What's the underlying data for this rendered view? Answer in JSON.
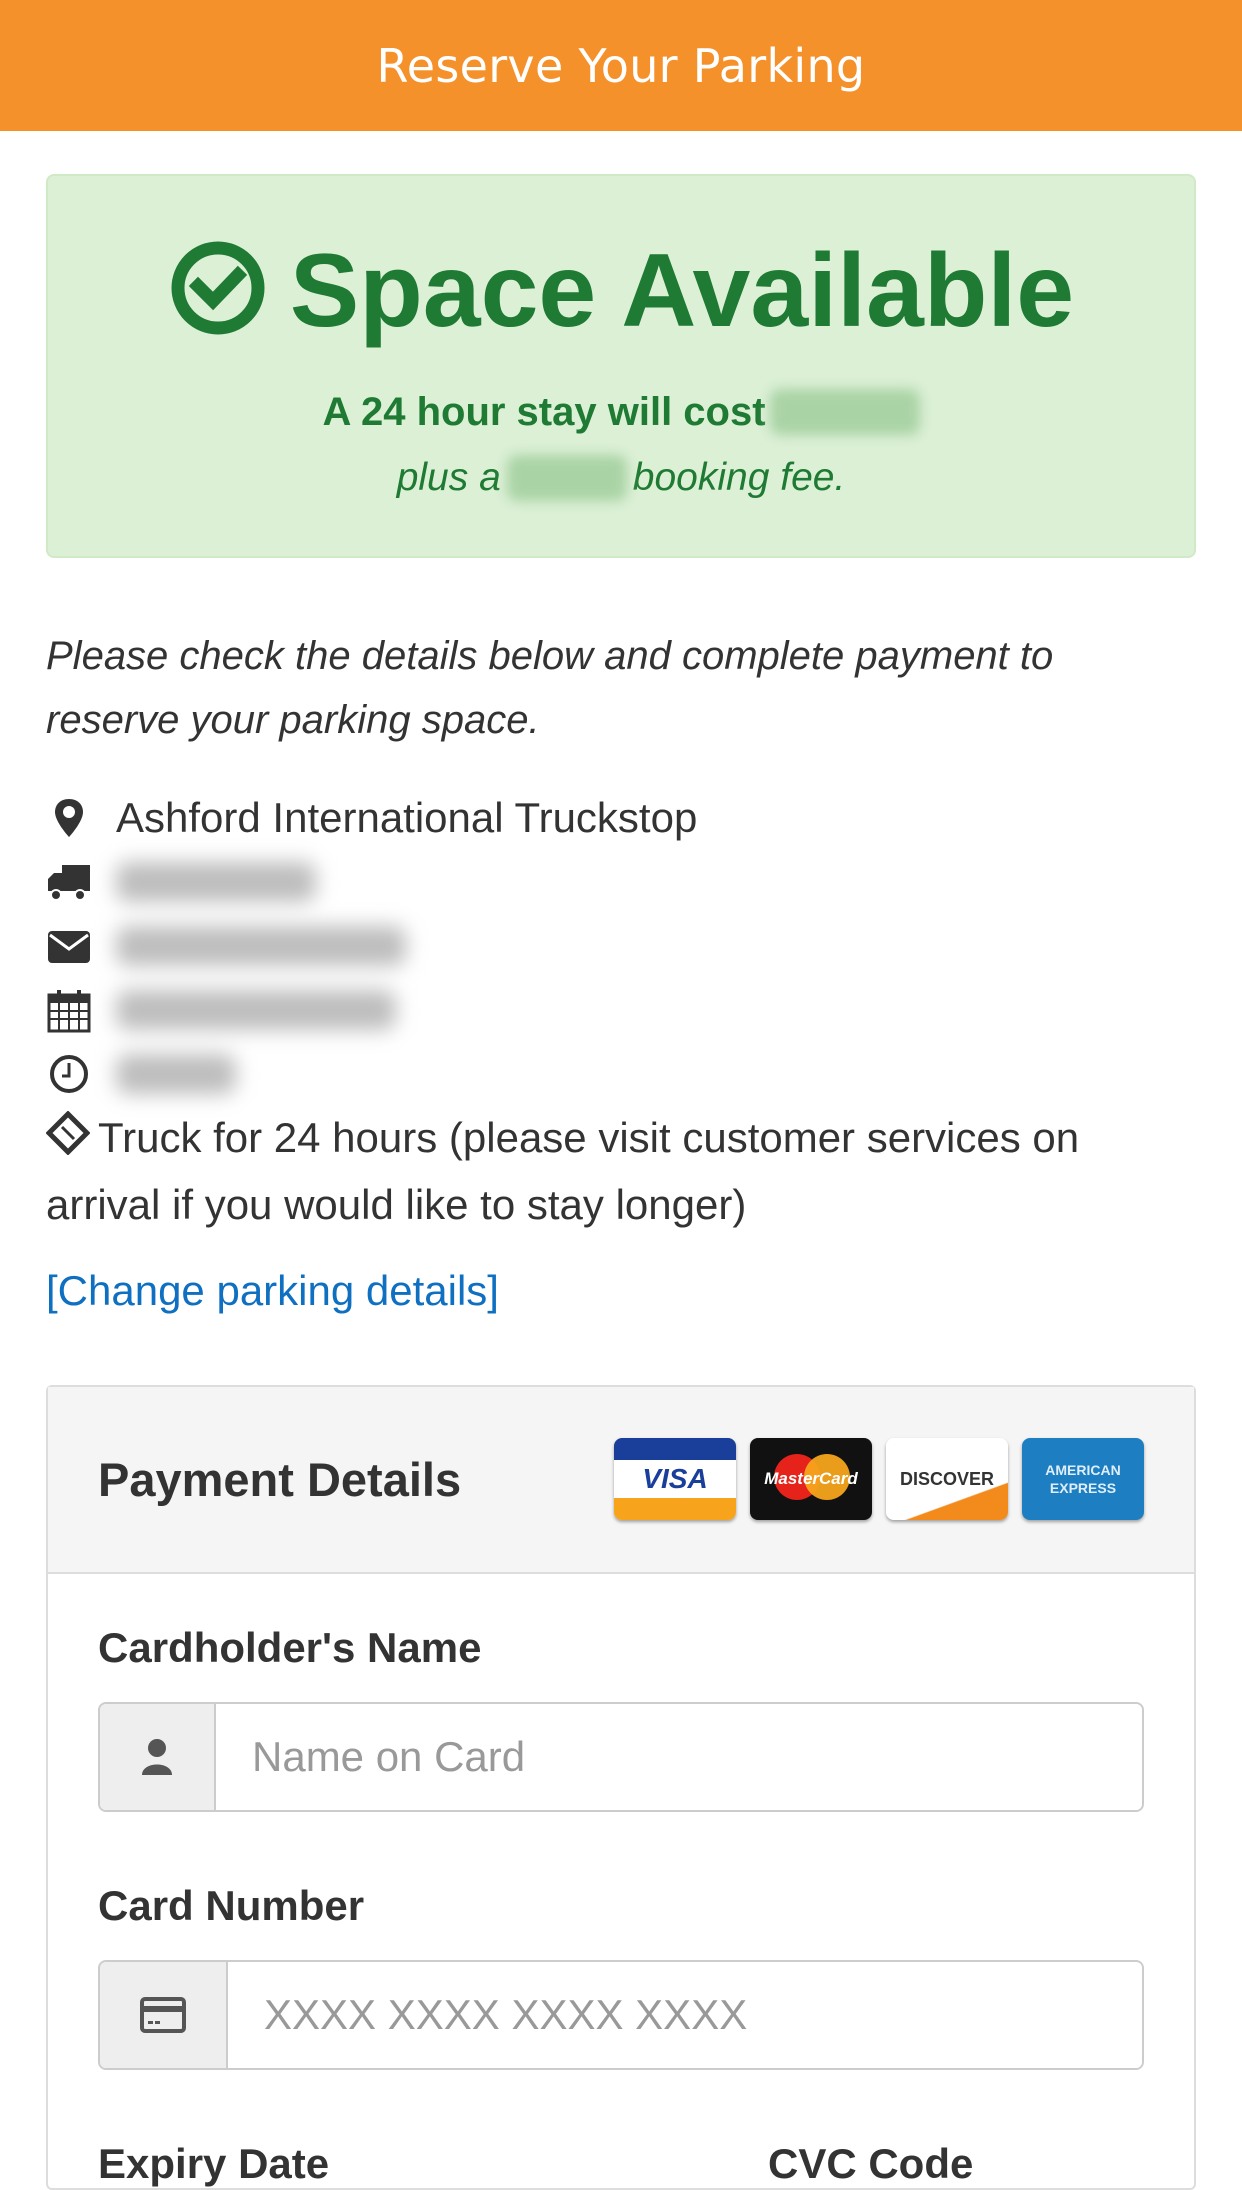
{
  "header": {
    "title": "Reserve Your Parking"
  },
  "availability": {
    "status": "Space Available",
    "status_icon": "check-circle-icon",
    "cost_prefix": "A 24 hour stay will cost",
    "cost_value": "[redacted]",
    "fee_prefix": "plus a",
    "fee_value": "[redacted]",
    "fee_suffix": "booking fee.",
    "color": "#1f7a34",
    "background": "#dcf0d6"
  },
  "intro": "Please check the details below and complete payment to reserve your parking space.",
  "details": [
    {
      "icon": "map-marker-icon",
      "text": "Ashford International Truckstop",
      "redacted": false
    },
    {
      "icon": "truck-icon",
      "text": "[redacted]",
      "redacted": true
    },
    {
      "icon": "envelope-icon",
      "text": "[redacted]",
      "redacted": true
    },
    {
      "icon": "calendar-icon",
      "text": "[redacted]",
      "redacted": true
    },
    {
      "icon": "clock-icon",
      "text": "[redacted]",
      "redacted": true
    }
  ],
  "ticket": {
    "icon": "tag-icon",
    "text": "Truck for 24 hours (please visit customer services on arrival if you would like to stay longer)"
  },
  "change_link": "[Change parking details]",
  "payment": {
    "title": "Payment Details",
    "cards": [
      {
        "name": "VISA",
        "icon": "visa-card-icon"
      },
      {
        "name": "MasterCard",
        "icon": "mastercard-icon"
      },
      {
        "name": "DISCOVER",
        "icon": "discover-card-icon"
      },
      {
        "name": "AMERICAN EXPRESS",
        "icon": "amex-card-icon"
      }
    ],
    "fields": {
      "name": {
        "label": "Cardholder's Name",
        "placeholder": "Name on Card",
        "value": ""
      },
      "number": {
        "label": "Card Number",
        "placeholder": "XXXX XXXX XXXX XXXX",
        "value": ""
      },
      "expiry": {
        "label": "Expiry Date"
      },
      "cvc": {
        "label": "CVC Code"
      }
    }
  },
  "colors": {
    "header": "#f5912a",
    "link": "#0f6fc0"
  }
}
